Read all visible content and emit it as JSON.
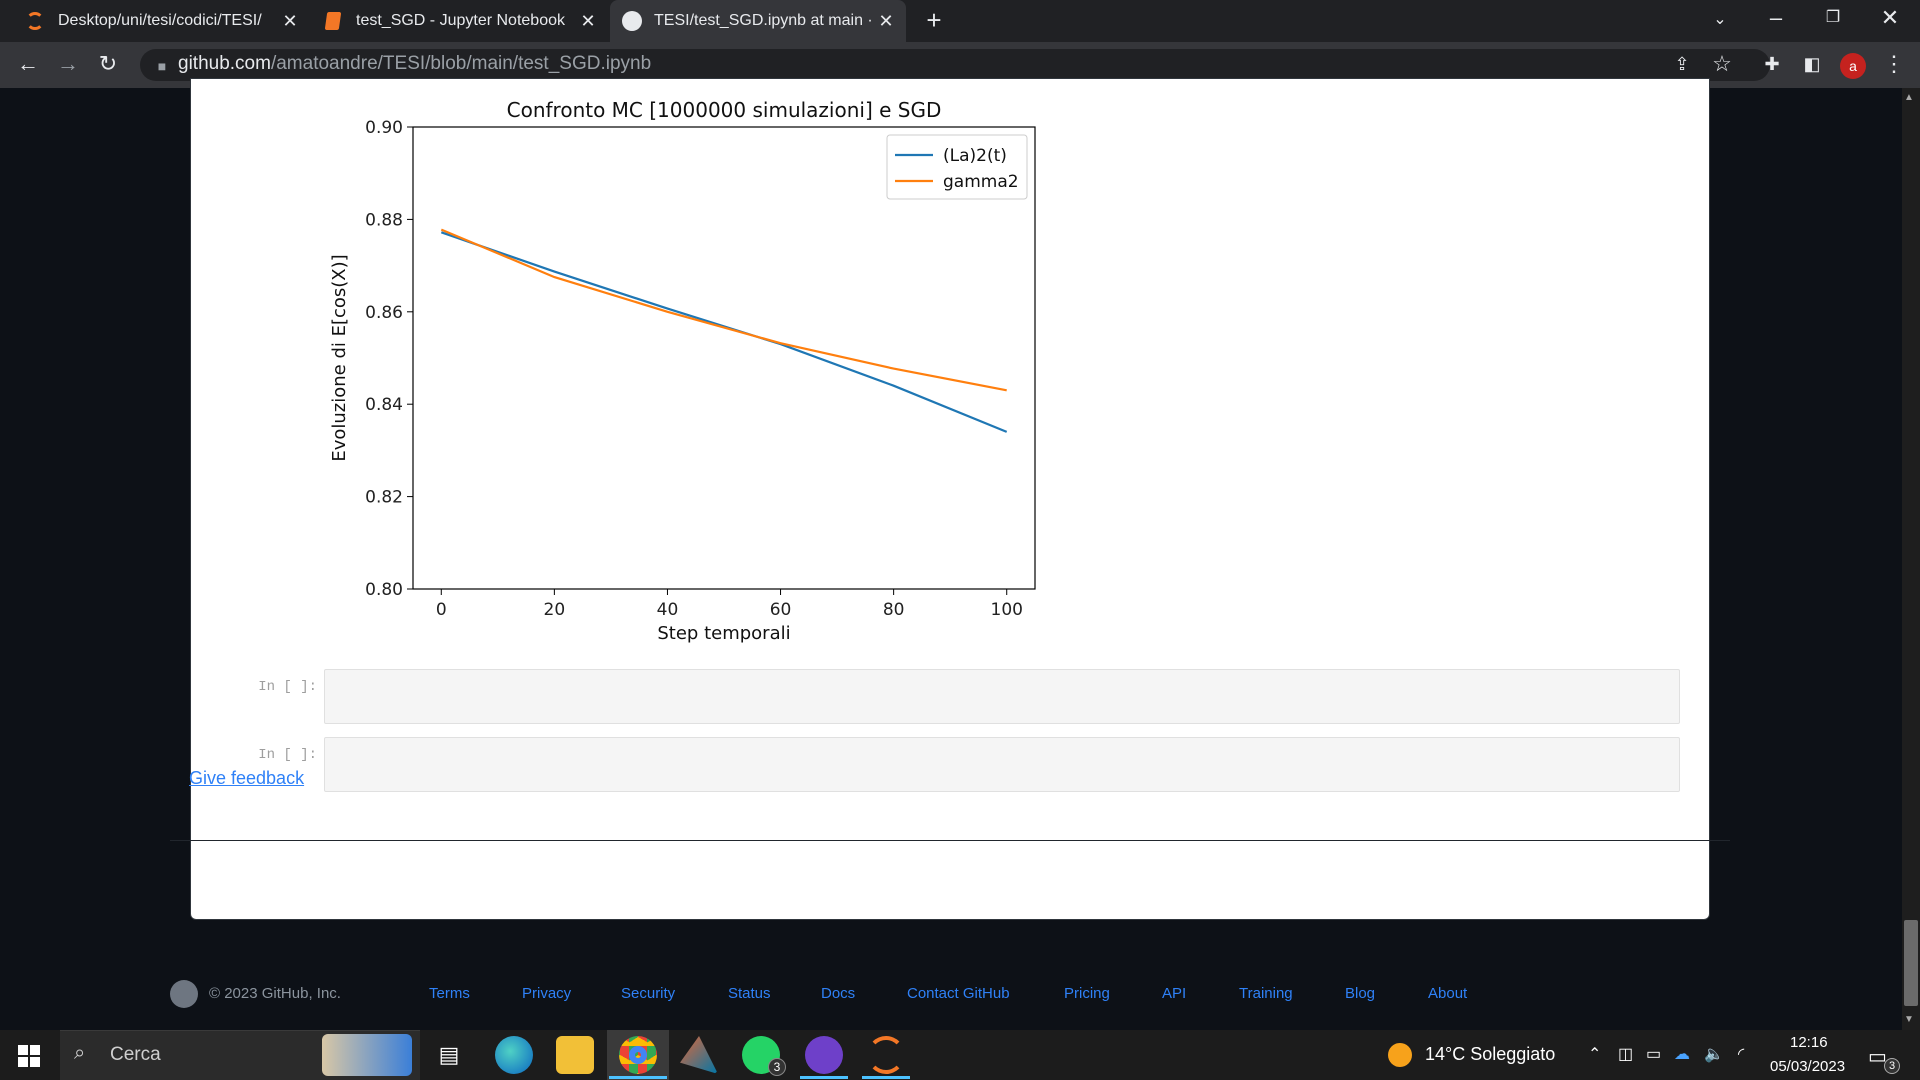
{
  "browser": {
    "tabs": [
      {
        "title": "Desktop/uni/tesi/codici/TESI/"
      },
      {
        "title": "test_SGD - Jupyter Notebook"
      },
      {
        "title": "TESI/test_SGD.ipynb at main · am"
      }
    ],
    "url_host": "github.com",
    "url_path": "/amatoandre/TESI/blob/main/test_SGD.ipynb",
    "profile_initial": "a"
  },
  "notebook": {
    "cells": [
      {
        "prompt": "In [ ]:"
      },
      {
        "prompt": "In [ ]:"
      }
    ]
  },
  "chart_data": {
    "type": "line",
    "title": "Confronto MC [1000000 simulazioni] e SGD",
    "xlabel": "Step temporali",
    "ylabel": "Evoluzione di E[cos(X)]",
    "xlim": [
      -5,
      105
    ],
    "ylim": [
      0.8,
      0.9
    ],
    "xticks": [
      "0",
      "20",
      "40",
      "60",
      "80",
      "100"
    ],
    "yticks": [
      "0.80",
      "0.82",
      "0.84",
      "0.86",
      "0.88",
      "0.90"
    ],
    "legend_position": "top-right",
    "series": [
      {
        "name": "(La)2(t)",
        "color": "#1f77b4",
        "x": [
          0,
          20,
          40,
          60,
          80,
          100
        ],
        "values": [
          0.8772,
          0.8687,
          0.8607,
          0.853,
          0.844,
          0.834
        ]
      },
      {
        "name": "gamma2",
        "color": "#ff7f0e",
        "x": [
          0,
          20,
          40,
          60,
          80,
          100
        ],
        "values": [
          0.8778,
          0.8675,
          0.86,
          0.8532,
          0.8477,
          0.843
        ]
      }
    ]
  },
  "footer": {
    "feedback": "Give feedback",
    "copyright": "© 2023 GitHub, Inc.",
    "links": [
      "Terms",
      "Privacy",
      "Security",
      "Status",
      "Docs",
      "Contact GitHub",
      "Pricing",
      "API",
      "Training",
      "Blog",
      "About"
    ]
  },
  "taskbar": {
    "search": "Cerca",
    "weather": "14°C  Soleggiato",
    "time": "12:16",
    "date": "05/03/2023",
    "whatsapp_badge": "3",
    "notification_badge": "3"
  }
}
